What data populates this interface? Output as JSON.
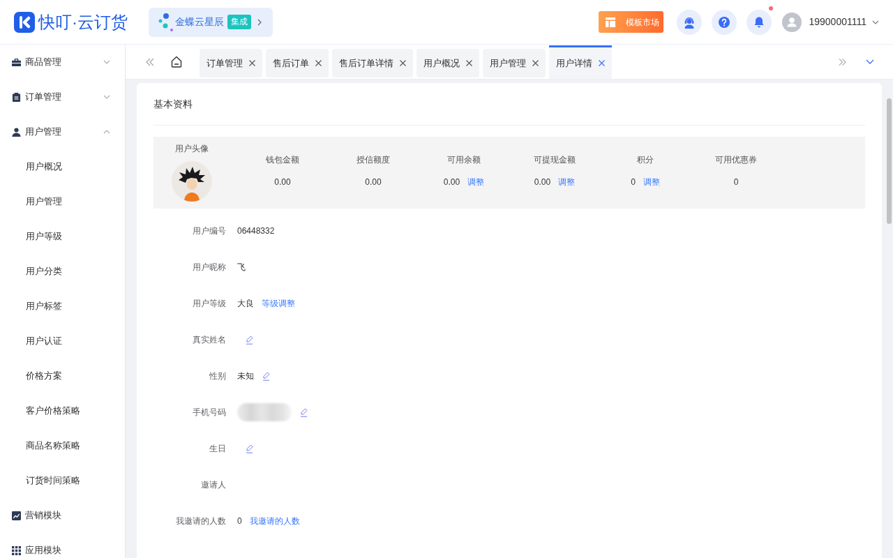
{
  "header": {
    "logo_text": "快叮·云订货",
    "partner": {
      "name": "金蝶云星辰",
      "badge": "集成"
    },
    "template_button": "模板市场",
    "unread_notifications": true,
    "user": {
      "phone": "19900001111"
    }
  },
  "sidebar": {
    "items": [
      {
        "label": "商品管理",
        "kind": "submenu",
        "expanded": false
      },
      {
        "label": "订单管理",
        "kind": "submenu",
        "expanded": false
      },
      {
        "label": "用户管理",
        "kind": "submenu",
        "expanded": true,
        "children": [
          {
            "label": "用户概况"
          },
          {
            "label": "用户管理"
          },
          {
            "label": "用户等级"
          },
          {
            "label": "用户分类"
          },
          {
            "label": "用户标签"
          },
          {
            "label": "用户认证"
          },
          {
            "label": "价格方案"
          },
          {
            "label": "客户价格策略"
          },
          {
            "label": "商品名称策略"
          },
          {
            "label": "订货时间策略"
          }
        ]
      },
      {
        "label": "营销模块",
        "kind": "item"
      },
      {
        "label": "应用模块",
        "kind": "item"
      }
    ]
  },
  "tabs": [
    {
      "label": "订单管理",
      "selected": false
    },
    {
      "label": "售后订单",
      "selected": false
    },
    {
      "label": "售后订单详情",
      "selected": false
    },
    {
      "label": "用户概况",
      "selected": false
    },
    {
      "label": "用户管理",
      "selected": false
    },
    {
      "label": "用户详情",
      "selected": true
    }
  ],
  "section_title": "基本资料",
  "summary": {
    "avatar_label": "用户头像",
    "stats": [
      {
        "label": "钱包金额",
        "value": "0.00"
      },
      {
        "label": "授信额度",
        "value": "0.00"
      },
      {
        "label": "可用余额",
        "value": "0.00",
        "link": "调整"
      },
      {
        "label": "可提现金额",
        "value": "0.00",
        "link": "调整"
      },
      {
        "label": "积分",
        "value": "0",
        "link": "调整"
      },
      {
        "label": "可用优惠券",
        "value": "0"
      }
    ]
  },
  "fields": [
    {
      "label": "用户编号",
      "kind": "text",
      "value": "06448332",
      "editable": false
    },
    {
      "label": "用户昵称",
      "kind": "text",
      "value": "飞",
      "editable": false
    },
    {
      "label": "用户等级",
      "kind": "text",
      "value": "大良",
      "link": "等级调整",
      "editable": false
    },
    {
      "label": "真实姓名",
      "kind": "text",
      "editable": true
    },
    {
      "label": "性别",
      "kind": "text",
      "value": "未知",
      "editable": true
    },
    {
      "label": "手机号码",
      "kind": "masked",
      "editable": true
    },
    {
      "label": "生日",
      "kind": "text",
      "editable": true
    },
    {
      "label": "邀请人",
      "kind": "text",
      "editable": false
    },
    {
      "label": "我邀请的人数",
      "kind": "text",
      "value": "0",
      "link": "我邀请的人数",
      "editable": false
    }
  ]
}
